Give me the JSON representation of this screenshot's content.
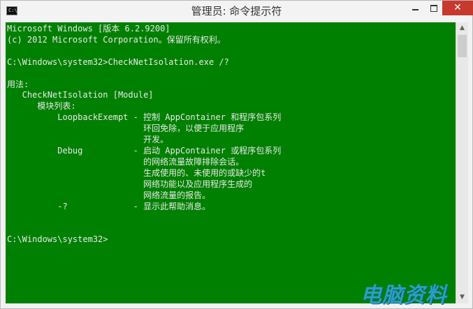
{
  "window": {
    "title": "管理员: 命令提示符",
    "icon_label": "C:\\",
    "minimize_symbol": "",
    "maximize_symbol": "",
    "close_symbol": "✕"
  },
  "console": {
    "lines": [
      "Microsoft Windows [版本 6.2.9200]",
      "(c) 2012 Microsoft Corporation。保留所有权利。",
      "",
      "C:\\Windows\\system32>CheckNetIsolation.exe /?",
      "",
      "用法:",
      "   CheckNetIsolation [Module]",
      "      模块列表:",
      "          LoopbackExempt - 控制 AppContainer 和程序包系列",
      "                           环回免除，以便于应用程序",
      "                           开发。",
      "          Debug          - 启动 AppContainer 或程序包系列",
      "                           的网络流量故障排除会话。",
      "                           生成使用的、未使用的或缺少的t",
      "                           网络功能以及应用程序生成的",
      "                           网络流量的报告。",
      "          -?             - 显示此帮助消息。",
      "",
      "",
      "C:\\Windows\\system32>"
    ]
  },
  "scrollbar": {
    "up_arrow": "▲",
    "down_arrow": "▼"
  },
  "watermark": {
    "text": "电脑资料"
  },
  "colors": {
    "console_background": "#008000",
    "console_text": "#e8e8e8",
    "close_button": "#c7392d"
  }
}
